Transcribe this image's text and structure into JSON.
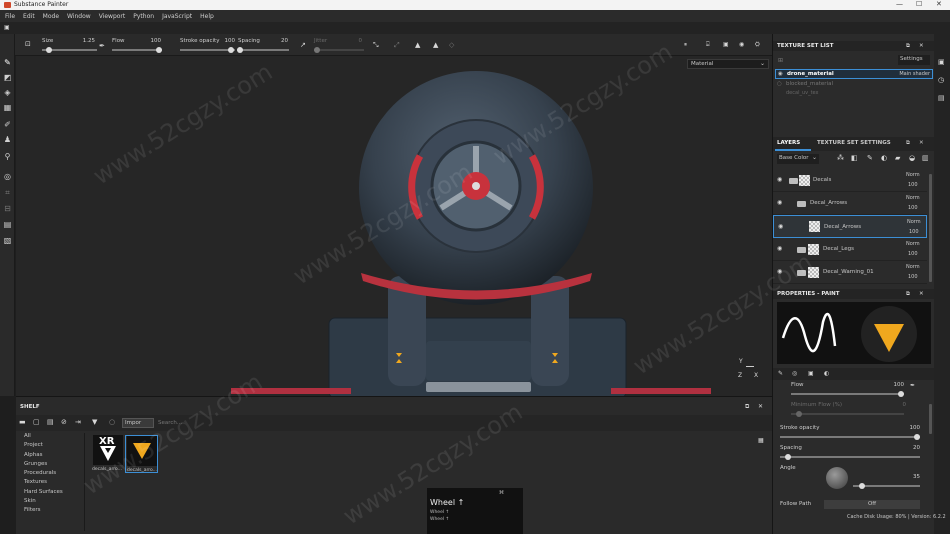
{
  "app": {
    "title": "Substance Painter",
    "window_controls": [
      "—",
      "☐",
      "✕"
    ]
  },
  "menu": [
    "File",
    "Edit",
    "Mode",
    "Window",
    "Viewport",
    "Python",
    "JavaScript",
    "Help"
  ],
  "toolbar": {
    "size_label": "Size",
    "size_value": "1.25",
    "flow_label": "Flow",
    "flow_value": "100",
    "stroke_opacity_label": "Stroke opacity",
    "stroke_opacity_value": "100",
    "spacing_label": "Spacing",
    "spacing_value": "20",
    "jitter_label": "Jitter",
    "jitter_value": "0",
    "viewport_mode": "Material"
  },
  "texture_set_list": {
    "title": "TEXTURE SET LIST",
    "settings_label": "Settings",
    "items": [
      {
        "name": "drone_material",
        "shader": "Main shader",
        "active": true
      },
      {
        "name": "blocked_material",
        "shader": "",
        "active": false
      },
      {
        "name": "decal_uv_tex",
        "shader": "",
        "active": false
      }
    ]
  },
  "layers_panel": {
    "tab_layers": "LAYERS",
    "tab_texture_set_settings": "TEXTURE SET SETTINGS",
    "channel": "Base Color",
    "layers": [
      {
        "name": "Decals",
        "blend": "Norm",
        "opacity": "100",
        "type": "folder",
        "indent": 0
      },
      {
        "name": "Decal_Arrows",
        "blend": "Norm",
        "opacity": "100",
        "type": "folder",
        "indent": 1
      },
      {
        "name": "Decal_Arrows",
        "blend": "Norm",
        "opacity": "100",
        "type": "fill",
        "indent": 2,
        "selected": true
      },
      {
        "name": "Decal_Legs",
        "blend": "Norm",
        "opacity": "100",
        "type": "folder",
        "indent": 1
      },
      {
        "name": "Decal_Warning_01",
        "blend": "Norm",
        "opacity": "100",
        "type": "folder",
        "indent": 1
      }
    ]
  },
  "properties": {
    "title": "PROPERTIES - PAINT",
    "flow_label": "Flow",
    "flow_value": "100",
    "flow_fraction": 1.0,
    "min_flow_label": "Minimum Flow (%)",
    "min_flow_value": "0",
    "stroke_opacity_label": "Stroke opacity",
    "stroke_opacity_value": "100",
    "stroke_opacity_fraction": 1.0,
    "spacing_label": "Spacing",
    "spacing_value": "20",
    "spacing_fraction": 0.04,
    "angle_label": "Angle",
    "angle_value": "35",
    "angle_fraction": 0.1,
    "follow_path_label": "Follow Path",
    "follow_path_value": "Off"
  },
  "shelf": {
    "title": "SHELF",
    "filter_tag": "Impor",
    "search_placeholder": "Search...",
    "categories": [
      "All",
      "Project",
      "Alphas",
      "Grunges",
      "Procedurals",
      "Textures",
      "Hard Surfaces",
      "Skin",
      "Filters"
    ],
    "items": [
      {
        "label": "decals_arro...",
        "badge": "XR"
      },
      {
        "label": "decals_arro...",
        "badge": ""
      }
    ]
  },
  "wheel_popup": {
    "title": "Wheel ↑",
    "shortcut": "⌘",
    "lines": [
      "Wheel ↑",
      "Wheel ↑"
    ]
  },
  "status": {
    "text": "Cache Disk Usage: 80% | Version: 6.2.2"
  },
  "gizmo": {
    "y": "Y",
    "z": "Z",
    "x": "X"
  },
  "watermark": "www.52cgzy.com",
  "colors": {
    "accent_red": "#c8323c",
    "accent_yellow": "#f0a81e",
    "panel_bg": "#2b2b2b",
    "selection_border": "#3c8fd6"
  }
}
